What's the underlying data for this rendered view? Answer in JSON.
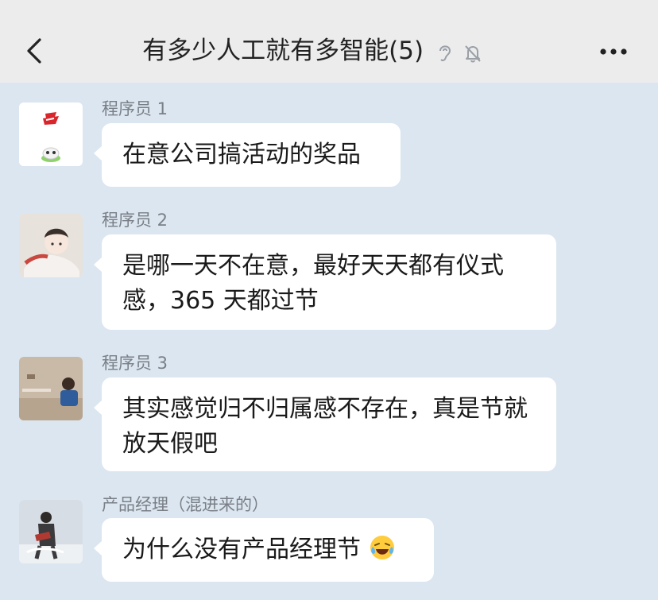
{
  "header": {
    "title": "有多少人工就有多智能(5)",
    "back_icon": "chevron-left-icon",
    "ear_icon": "ear-icon",
    "mute_icon": "bell-mute-icon",
    "more_icon": "more-dots-icon"
  },
  "messages": [
    {
      "sender": "程序员 1",
      "text": "在意公司搞活动的奖品"
    },
    {
      "sender": "程序员 2",
      "text": "是哪一天不在意，最好天天都有仪式感，365 天都过节"
    },
    {
      "sender": "程序员 3",
      "text": "其实感觉归不归属感不存在，真是节就放天假吧"
    },
    {
      "sender": "产品经理（混进来的）",
      "text": "为什么没有产品经理节"
    }
  ],
  "colors": {
    "background": "#dbe6f0",
    "header": "#ececed",
    "bubble": "#ffffff"
  }
}
